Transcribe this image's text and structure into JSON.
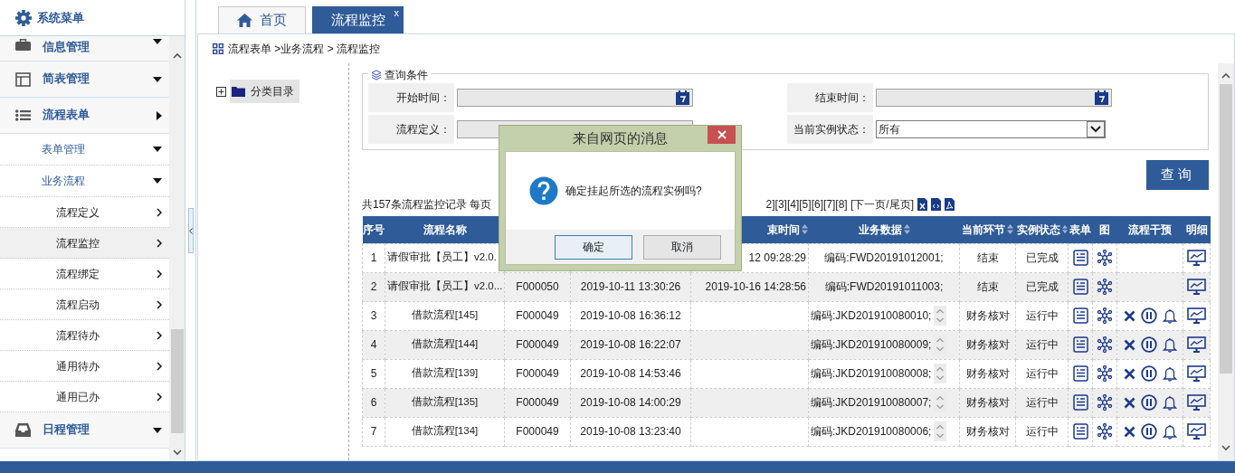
{
  "sidebar": {
    "title": "系统菜单",
    "items": [
      {
        "label": "信息管理",
        "kind": "down"
      },
      {
        "label": "简表管理",
        "kind": "down"
      },
      {
        "label": "流程表单",
        "kind": "right",
        "children": [
          {
            "label": "表单管理",
            "kind": "down"
          },
          {
            "label": "业务流程",
            "kind": "down",
            "children": [
              {
                "label": "流程定义",
                "selected": false
              },
              {
                "label": "流程监控",
                "selected": true
              },
              {
                "label": "流程绑定",
                "selected": false
              },
              {
                "label": "流程启动",
                "selected": false
              },
              {
                "label": "流程待办",
                "selected": false
              },
              {
                "label": "通用待办",
                "selected": false
              },
              {
                "label": "通用已办",
                "selected": false
              }
            ]
          }
        ]
      },
      {
        "label": "日程管理",
        "kind": "down"
      }
    ]
  },
  "tabs": [
    {
      "label": "首页",
      "selected": false
    },
    {
      "label": "流程监控",
      "selected": true,
      "close": "x"
    }
  ],
  "breadcrumb": "流程表单 >业务流程 > 流程监控",
  "tree": {
    "label": "分类目录",
    "expanded": false,
    "selected": true
  },
  "query": {
    "legend": "查询条件",
    "fields": [
      {
        "label": "开始时间：",
        "kind": "date"
      },
      {
        "label": "结束时间：",
        "kind": "date"
      },
      {
        "label": "流程定义：",
        "kind": "text"
      },
      {
        "label": "当前实例状态：",
        "kind": "select",
        "value": "所有"
      }
    ],
    "button": "查询"
  },
  "pager": {
    "summary": "共157条流程监控记录  每页",
    "pages": "2][3][4][5][6][7][8] [下一页/尾页]"
  },
  "table": {
    "columns": [
      {
        "label": "序号",
        "sortable": false
      },
      {
        "label": "流程名称",
        "sortable": false
      },
      {},
      {},
      {
        "label": "束时间",
        "sortable": true
      },
      {
        "label": "业务数据",
        "sortable": true
      },
      {
        "label": "当前环节",
        "sortable": true
      },
      {
        "label": "实例状态",
        "sortable": true
      },
      {
        "label": "表单",
        "sortable": false
      },
      {
        "label": "图",
        "sortable": false
      },
      {
        "label": "流程干预",
        "sortable": false
      },
      {
        "label": "明细",
        "sortable": false
      }
    ],
    "rows": [
      {
        "no": "1",
        "name": "请假审批【员工】v2.0.",
        "end": "12 09:28:29",
        "data": "编码:FWD20191012001;",
        "stage": "结束",
        "status": "已完成",
        "overflow": false,
        "intervene": false
      },
      {
        "no": "2",
        "name": "请假审批【员工】v2.0...",
        "code": "F000050",
        "start": "2019-10-11 13:30:26",
        "end": "2019-10-16 14:28:56",
        "data": "编码:FWD20191011003;",
        "stage": "结束",
        "status": "已完成",
        "overflow": false,
        "intervene": false
      },
      {
        "no": "3",
        "name": "借款流程[145]",
        "code": "F000049",
        "start": "2019-10-08 16:36:12",
        "data": "编码:JKD201910080010;",
        "stage": "财务核对",
        "status": "运行中",
        "overflow": true,
        "intervene": true
      },
      {
        "no": "4",
        "name": "借款流程[144]",
        "code": "F000049",
        "start": "2019-10-08 16:22:07",
        "data": "编码:JKD201910080009;",
        "stage": "财务核对",
        "status": "运行中",
        "overflow": true,
        "intervene": true
      },
      {
        "no": "5",
        "name": "借款流程[139]",
        "code": "F000049",
        "start": "2019-10-08 14:53:46",
        "data": "编码:JKD201910080008;",
        "stage": "财务核对",
        "status": "运行中",
        "overflow": true,
        "intervene": true
      },
      {
        "no": "6",
        "name": "借款流程[135]",
        "code": "F000049",
        "start": "2019-10-08 14:00:29",
        "data": "编码:JKD201910080007;",
        "stage": "财务核对",
        "status": "运行中",
        "overflow": true,
        "intervene": true
      },
      {
        "no": "7",
        "name": "借款流程[134]",
        "code": "F000049",
        "start": "2019-10-08 13:23:40",
        "data": "编码:JKD201910080006;",
        "stage": "财务核对",
        "status": "运行中",
        "overflow": true,
        "intervene": true
      }
    ]
  },
  "dialog": {
    "title": "来自网页的消息",
    "message": "确定挂起所选的流程实例吗?",
    "buttons": [
      {
        "label": "确定",
        "selected": true
      },
      {
        "label": "取消",
        "selected": false
      }
    ]
  }
}
